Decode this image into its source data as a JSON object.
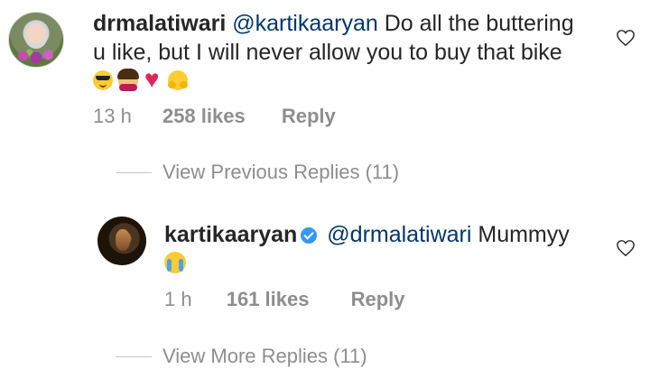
{
  "comment1": {
    "username": "drmalatiwari",
    "mention": "@kartikaaryan",
    "line1_text": "Do all the buttering",
    "line2_text": "u like, but I will never allow you to buy that bike",
    "emojis": [
      "smiling-face-with-sunglasses",
      "woman-gesturing-no",
      "red-heart",
      "hugging-face"
    ],
    "time": "13 h",
    "likes": "258 likes",
    "reply_label": "Reply"
  },
  "view_previous": {
    "label": "View Previous Replies (11)"
  },
  "comment2": {
    "username": "kartikaaryan",
    "verified": true,
    "mention": "@drmalatiwari",
    "text": "Mummyy",
    "emojis": [
      "loudly-crying-face"
    ],
    "time": "1 h",
    "likes": "161 likes",
    "reply_label": "Reply"
  },
  "view_more": {
    "label": "View More Replies (11)"
  },
  "colors": {
    "text": "#262626",
    "secondary": "#8e8e8e",
    "mention": "#00376b",
    "verified": "#3897f0",
    "divider": "#c7c7c7"
  },
  "icons": {
    "like": "heart-outline-icon",
    "verified": "verified-badge-icon"
  }
}
